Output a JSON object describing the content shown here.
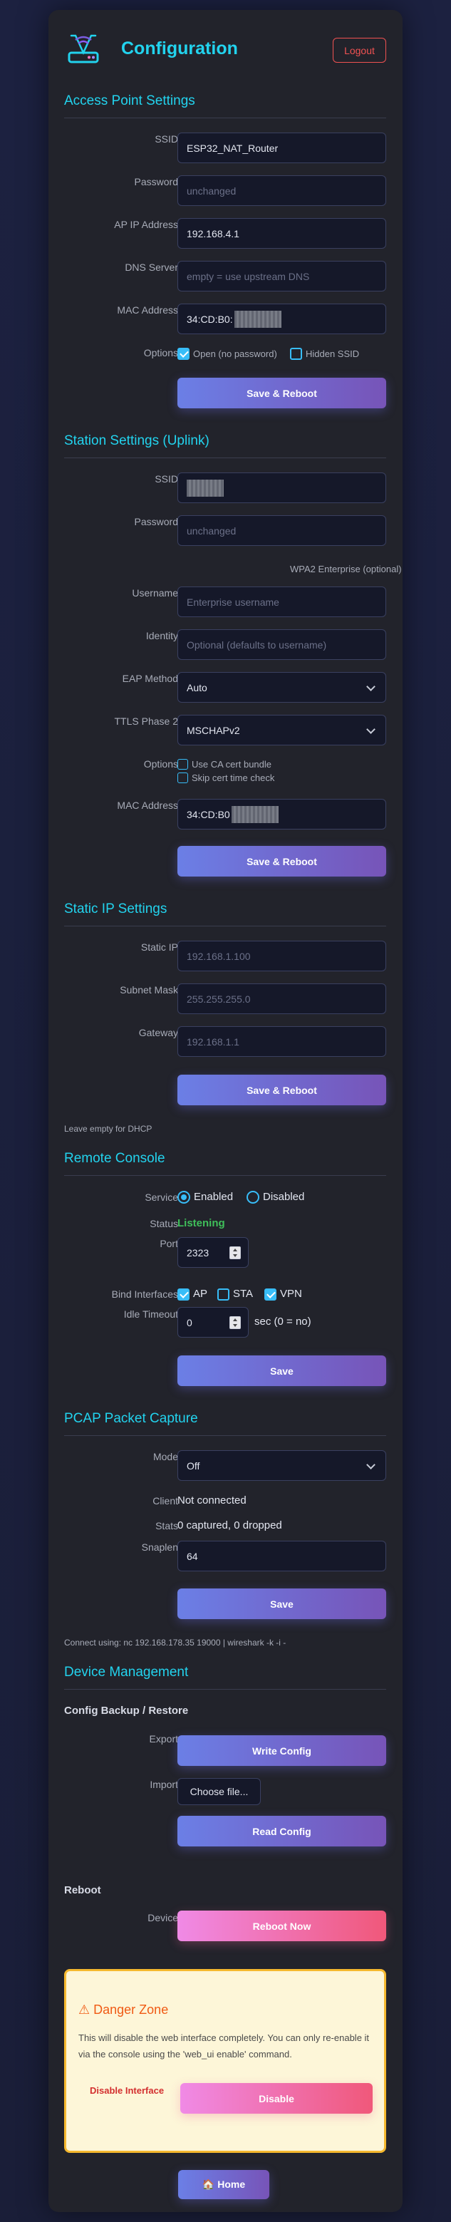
{
  "header": {
    "title": "Configuration",
    "logout_label": "Logout",
    "logo_icon": "router-wifi-icon"
  },
  "ap": {
    "title": "Access Point Settings",
    "ssid_label": "SSID",
    "ssid_value": "ESP32_NAT_Router",
    "password_label": "Password",
    "password_placeholder": "unchanged",
    "ip_label": "AP IP Address",
    "ip_value": "192.168.4.1",
    "dns_label": "DNS Server",
    "dns_placeholder": "empty = use upstream DNS",
    "mac_label": "MAC Address",
    "mac_value": "34:CD:B0:",
    "options_label": "Options",
    "open_label": "Open (no password)",
    "hidden_label": "Hidden SSID",
    "save_label": "Save & Reboot"
  },
  "sta": {
    "title": "Station Settings (Uplink)",
    "ssid_label": "SSID",
    "password_label": "Password",
    "password_placeholder": "unchanged",
    "enterprise_note": "WPA2 Enterprise (optional)",
    "username_label": "Username",
    "username_placeholder": "Enterprise username",
    "identity_label": "Identity",
    "identity_placeholder": "Optional (defaults to username)",
    "eap_label": "EAP Method",
    "eap_value": "Auto",
    "ttls_label": "TTLS Phase 2",
    "ttls_value": "MSCHAPv2",
    "options_label": "Options",
    "ca_label": "Use CA cert bundle",
    "skip_time_label": "Skip cert time check",
    "mac_label": "MAC Address",
    "mac_value": "34:CD:B0",
    "save_label": "Save & Reboot"
  },
  "static_ip": {
    "title": "Static IP Settings",
    "ip_label": "Static IP",
    "ip_placeholder": "192.168.1.100",
    "mask_label": "Subnet Mask",
    "mask_placeholder": "255.255.255.0",
    "gw_label": "Gateway",
    "gw_placeholder": "192.168.1.1",
    "save_label": "Save & Reboot",
    "note": "Leave empty for DHCP"
  },
  "console": {
    "title": "Remote Console",
    "service_label": "Service",
    "enabled_label": "Enabled",
    "disabled_label": "Disabled",
    "status_label": "Status",
    "status_value": "Listening",
    "status_color": "#3fbf5a",
    "port_label": "Port",
    "port_value": "2323",
    "bind_label": "Bind Interfaces",
    "bind_ap": "AP",
    "bind_sta": "STA",
    "bind_vpn": "VPN",
    "idle_label": "Idle Timeout",
    "idle_value": "0",
    "idle_suffix": "sec (0 = no)",
    "save_label": "Save"
  },
  "pcap": {
    "title": "PCAP Packet Capture",
    "mode_label": "Mode",
    "mode_value": "Off",
    "client_label": "Client",
    "client_value": "Not connected",
    "stats_label": "Stats",
    "stats_value": "0 captured, 0 dropped",
    "snaplen_label": "Snaplen",
    "snaplen_value": "64",
    "save_label": "Save",
    "note": "Connect using: nc 192.168.178.35 19000 | wireshark -k -i -"
  },
  "device": {
    "title": "Device Management",
    "backup_heading": "Config Backup / Restore",
    "export_label": "Export",
    "write_label": "Write Config",
    "import_label": "Import",
    "choose_label": "Choose file...",
    "read_label": "Read Config",
    "reboot_heading": "Reboot",
    "device_label": "Device",
    "reboot_label": "Reboot Now"
  },
  "danger": {
    "title": "⚠ Danger Zone",
    "text": "This will disable the web interface completely. You can only re-enable it via the console using the 'web_ui enable' command.",
    "disable_label": "Disable Interface",
    "disable_button": "Disable"
  },
  "footer": {
    "home_label": "🏠 Home"
  }
}
